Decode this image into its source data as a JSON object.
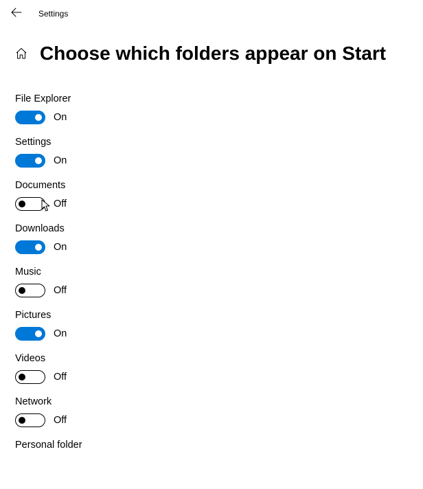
{
  "topbar": {
    "title": "Settings"
  },
  "page": {
    "title": "Choose which folders appear on Start"
  },
  "labels": {
    "on": "On",
    "off": "Off"
  },
  "items": [
    {
      "name": "File Explorer",
      "state": "on"
    },
    {
      "name": "Settings",
      "state": "on"
    },
    {
      "name": "Documents",
      "state": "off"
    },
    {
      "name": "Downloads",
      "state": "on"
    },
    {
      "name": "Music",
      "state": "off"
    },
    {
      "name": "Pictures",
      "state": "on"
    },
    {
      "name": "Videos",
      "state": "off"
    },
    {
      "name": "Network",
      "state": "off"
    },
    {
      "name": "Personal folder",
      "state": null
    }
  ],
  "cursor_on_item_index": 2
}
